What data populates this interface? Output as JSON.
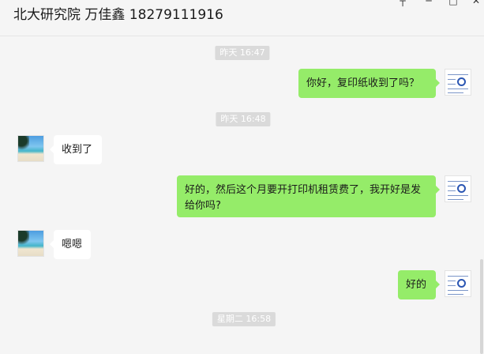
{
  "header": {
    "title": "北大研究院 万佳鑫 18279111916"
  },
  "messages": {
    "t1": "昨天 16:47",
    "m1": "你好，复印纸收到了吗？",
    "t2": "昨天 16:48",
    "m2": "收到了",
    "m3": "好的，然后这个月要开打印机租赁费了，我开好是发给你吗?",
    "m4": "嗯嗯",
    "m5": "好的",
    "t3": "星期二 16:58"
  },
  "colors": {
    "sent_bubble": "#95ec69",
    "received_bubble": "#ffffff",
    "background": "#f5f5f5",
    "timestamp_bg": "#dadada"
  },
  "icons": {
    "window_controls": [
      "pin-icon",
      "minimize-icon",
      "maximize-icon",
      "close-icon"
    ]
  }
}
